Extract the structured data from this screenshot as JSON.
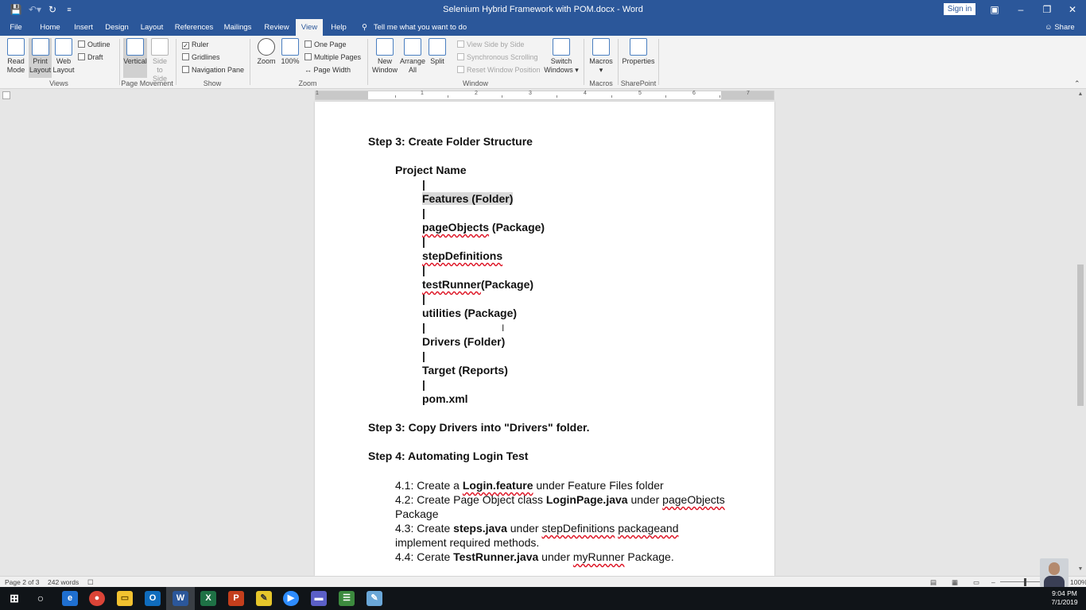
{
  "window": {
    "title": "Selenium Hybrid Framework with POM.docx  -  Word",
    "sign_in": "Sign in",
    "colors": {
      "titlebar": "#2b579a",
      "ribbon": "#f3f3f3"
    }
  },
  "menu": {
    "tabs": [
      "File",
      "Home",
      "Insert",
      "Design",
      "Layout",
      "References",
      "Mailings",
      "Review",
      "View",
      "Help"
    ],
    "active_tab": "View",
    "tell_me": "Tell me what you want to do",
    "share": "Share"
  },
  "ribbon": {
    "views": {
      "read_mode": [
        "Read",
        "Mode"
      ],
      "print_layout": [
        "Print",
        "Layout"
      ],
      "web_layout": [
        "Web",
        "Layout"
      ],
      "outline": "Outline",
      "draft": "Draft",
      "label": "Views"
    },
    "page_movement": {
      "vertical": "Vertical",
      "side_to_side": [
        "Side",
        "to Side"
      ],
      "label": "Page Movement"
    },
    "show": {
      "ruler": "Ruler",
      "gridlines": "Gridlines",
      "navigation_pane": "Navigation Pane",
      "label": "Show"
    },
    "zoom": {
      "zoom": "Zoom",
      "zoom100": "100%",
      "one_page": "One Page",
      "multiple_pages": "Multiple Pages",
      "page_width": "Page Width",
      "label": "Zoom"
    },
    "window": {
      "new_window": [
        "New",
        "Window"
      ],
      "arrange_all": [
        "Arrange",
        "All"
      ],
      "split": "Split",
      "view_side_by_side": "View Side by Side",
      "synchronous_scrolling": "Synchronous Scrolling",
      "reset_window_position": "Reset Window Position",
      "switch_windows": [
        "Switch",
        "Windows ▾"
      ],
      "label": "Window"
    },
    "macros": {
      "macros": [
        "Macros",
        "▾"
      ],
      "label": "Macros"
    },
    "sharepoint": {
      "properties": "Properties",
      "label": "SharePoint"
    }
  },
  "ruler_numbers": [
    "1",
    "1",
    "2",
    "3",
    "4",
    "5",
    "6",
    "7"
  ],
  "document": {
    "step3_heading": "Step 3: Create Folder Structure",
    "project_name": "Project Name",
    "pipe": "|",
    "tree": {
      "features": "Features (Folder)",
      "pageobjects_word": "pageObjects",
      "pageobjects_suffix": " (Package)",
      "stepdefinitions": "stepDefinitions",
      "testrunner_word": "testRunner",
      "testrunner_suffix": "(Package)",
      "utilities": "utilities (Package)",
      "drivers": "Drivers (Folder)",
      "target": "Target (Reports)",
      "pom": "pom.xml"
    },
    "step3b_heading": "Step 3: Copy Drivers into \"Drivers\" folder.",
    "step4_heading": "Step 4: Automating Login Test",
    "items": {
      "i41": {
        "pre": "4.1: Create a ",
        "bold": "Login.feature",
        "post": " under Feature Files folder"
      },
      "i42": {
        "pre": "4.2:  Create Page Object class ",
        "bold": "LoginPage.java",
        "mid": " under ",
        "sq": "pageObjects",
        "cont": "Package"
      },
      "i43": {
        "pre": "4.3:  Create ",
        "bold": "steps.java",
        "mid": " under ",
        "sq1": "stepDefinitions",
        "sp": " ",
        "sq2": "packageand",
        "cont": "implement required methods."
      },
      "i44": {
        "pre": "4.4:  Cerate ",
        "bold": "TestRunner.java",
        "mid": " under ",
        "sq": "myRunner",
        "post": " Package."
      }
    }
  },
  "status": {
    "page": "Page 2 of 3",
    "words": "242 words",
    "zoom": "100%"
  },
  "clock": {
    "time": "9:04 PM",
    "date": "7/1/2019"
  }
}
